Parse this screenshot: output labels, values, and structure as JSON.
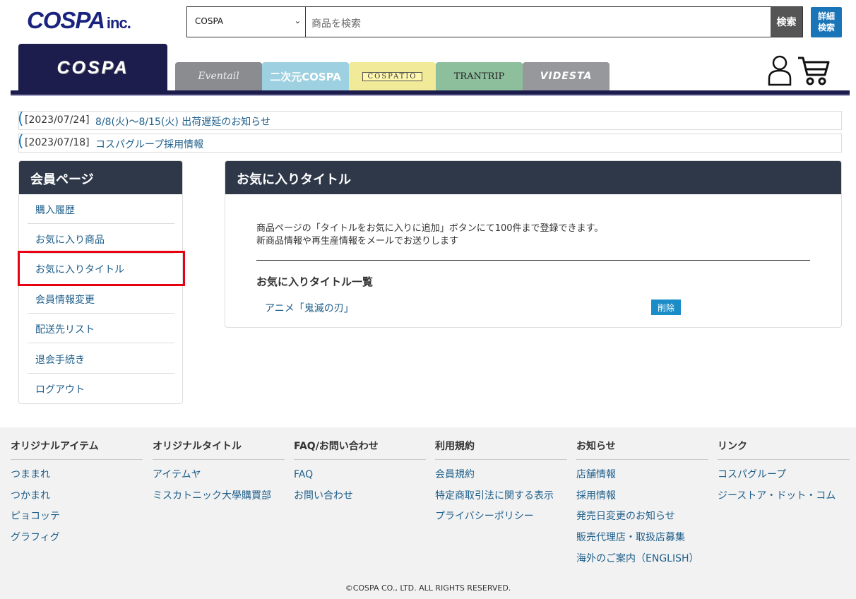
{
  "header": {
    "logo_main": "COSPA",
    "logo_sub": "inc.",
    "search": {
      "category": "COSPA",
      "placeholder": "商品を検索",
      "button": "検索"
    },
    "detail_search": [
      "詳細",
      "検索"
    ],
    "main_tab": "COSPA",
    "brand_tabs": [
      "Eventail",
      "二次元COSPA",
      "COSPATIO",
      "TRANTRIP",
      "VIDESTA"
    ]
  },
  "news": [
    {
      "date": "[2023/07/24]",
      "title": "8/8(火)～8/15(火) 出荷遅延のお知らせ"
    },
    {
      "date": "[2023/07/18]",
      "title": "コスパグループ採用情報"
    }
  ],
  "sidebar": {
    "heading": "会員ページ",
    "items": [
      "購入履歴",
      "お気に入り商品",
      "お気に入りタイトル",
      "会員情報変更",
      "配送先リスト",
      "退会手続き",
      "ログアウト"
    ]
  },
  "panel": {
    "heading": "お気に入りタイトル",
    "desc_line1": "商品ページの「タイトルをお気に入りに追加」ボタンにて100件まで登録できます。",
    "desc_line2": "新商品情報や再生産情報をメールでお送りします",
    "list_title": "お気に入りタイトル一覧",
    "favorite": "アニメ「鬼滅の刃」",
    "delete_label": "削除"
  },
  "footer": {
    "columns": [
      {
        "heading": "オリジナルアイテム",
        "links": [
          "つままれ",
          "つかまれ",
          "ピョコッテ",
          "グラフィグ"
        ]
      },
      {
        "heading": "オリジナルタイトル",
        "links": [
          "アイテムヤ",
          "ミスカトニック大學購買部"
        ]
      },
      {
        "heading": "FAQ/お問い合わせ",
        "links": [
          "FAQ",
          "お問い合わせ"
        ]
      },
      {
        "heading": "利用規約",
        "links": [
          "会員規約",
          "特定商取引法に関する表示",
          "プライバシーポリシー"
        ]
      },
      {
        "heading": "お知らせ",
        "links": [
          "店舗情報",
          "採用情報",
          "発売日変更のお知らせ",
          "販売代理店・取扱店募集",
          "海外のご案内（ENGLISH）"
        ]
      },
      {
        "heading": "リンク",
        "links": [
          "コスパグループ",
          "ジーストア・ドット・コム"
        ]
      }
    ],
    "copyright": "©COSPA CO., LTD. ALL RIGHTS RESERVED."
  }
}
